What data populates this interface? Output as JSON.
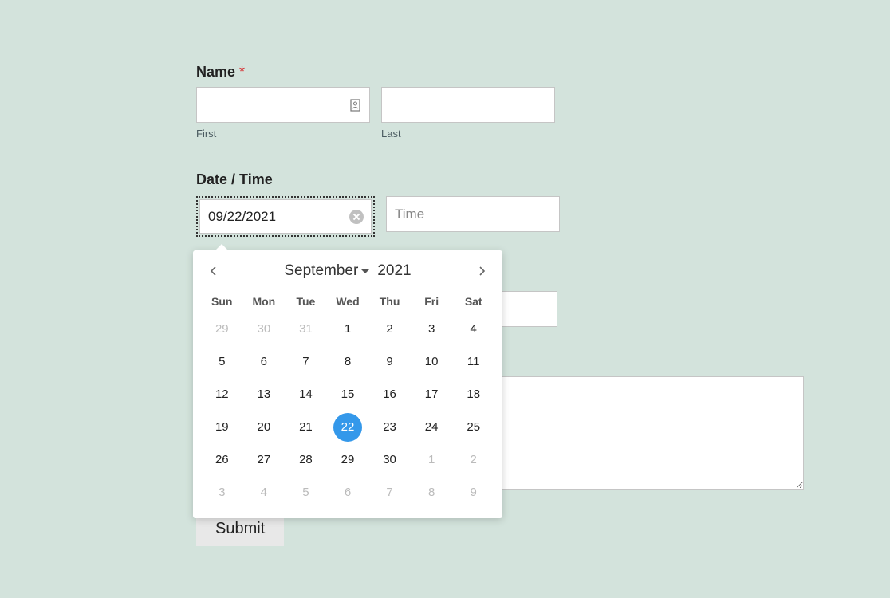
{
  "form": {
    "name_label": "Name",
    "required_mark": "*",
    "first_sub": "First",
    "last_sub": "Last",
    "datetime_label": "Date / Time",
    "date_value": "09/22/2021",
    "time_placeholder": "Time",
    "submit_label": "Submit"
  },
  "calendar": {
    "month": "September",
    "year": "2021",
    "day_headers": [
      "Sun",
      "Mon",
      "Tue",
      "Wed",
      "Thu",
      "Fri",
      "Sat"
    ],
    "selected_day": 22,
    "rows": [
      [
        {
          "n": "29",
          "muted": true
        },
        {
          "n": "30",
          "muted": true
        },
        {
          "n": "31",
          "muted": true
        },
        {
          "n": "1"
        },
        {
          "n": "2"
        },
        {
          "n": "3"
        },
        {
          "n": "4"
        }
      ],
      [
        {
          "n": "5"
        },
        {
          "n": "6"
        },
        {
          "n": "7"
        },
        {
          "n": "8"
        },
        {
          "n": "9"
        },
        {
          "n": "10"
        },
        {
          "n": "11"
        }
      ],
      [
        {
          "n": "12"
        },
        {
          "n": "13"
        },
        {
          "n": "14"
        },
        {
          "n": "15"
        },
        {
          "n": "16"
        },
        {
          "n": "17"
        },
        {
          "n": "18"
        }
      ],
      [
        {
          "n": "19"
        },
        {
          "n": "20"
        },
        {
          "n": "21"
        },
        {
          "n": "22",
          "selected": true
        },
        {
          "n": "23"
        },
        {
          "n": "24"
        },
        {
          "n": "25"
        }
      ],
      [
        {
          "n": "26"
        },
        {
          "n": "27"
        },
        {
          "n": "28"
        },
        {
          "n": "29"
        },
        {
          "n": "30"
        },
        {
          "n": "1",
          "muted": true
        },
        {
          "n": "2",
          "muted": true
        }
      ],
      [
        {
          "n": "3",
          "muted": true
        },
        {
          "n": "4",
          "muted": true
        },
        {
          "n": "5",
          "muted": true
        },
        {
          "n": "6",
          "muted": true
        },
        {
          "n": "7",
          "muted": true
        },
        {
          "n": "8",
          "muted": true
        },
        {
          "n": "9",
          "muted": true
        }
      ]
    ]
  }
}
